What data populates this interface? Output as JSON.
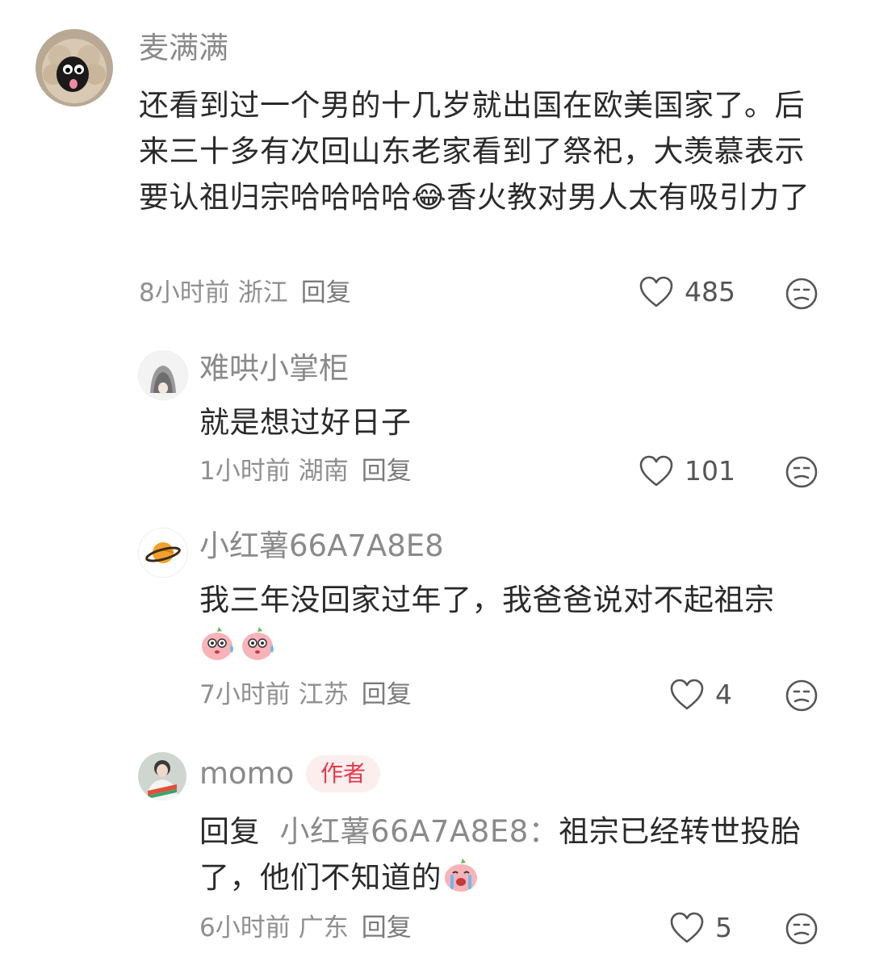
{
  "comments": [
    {
      "username": "麦满满",
      "text_before_emoji": "还看到过一个男的十几岁就出国在欧美国家了。后来三十多有次回山东老家看到了祭祀，大羡慕表示要认祖归宗哈哈哈哈",
      "emoji": "😂",
      "text_after_emoji": "香火教对男人太有吸引力了",
      "time": "8小时前",
      "location": "浙江",
      "reply_label": "回复",
      "likes": "485",
      "avatar_icon": "sheep-avatar"
    }
  ],
  "replies": [
    {
      "username": "难哄小掌柜",
      "text": "就是想过好日子",
      "time": "1小时前",
      "location": "湖南",
      "reply_label": "回复",
      "likes": "101",
      "avatar_icon": "grey-hair-avatar"
    },
    {
      "username": "小红薯66A7A8E8",
      "text": "我三年没回家过年了，我爸爸说对不起祖宗",
      "emoji_icon": "sweating-peach-emoji",
      "time": "7小时前",
      "location": "江苏",
      "reply_label": "回复",
      "likes": "4",
      "avatar_icon": "planet-avatar"
    },
    {
      "username": "momo",
      "badge": "作者",
      "reply_prefix": "回复",
      "mention": "小红薯66A7A8E8：",
      "text": "祖宗已经转世投胎了，他们不知道的",
      "emoji_icon": "crying-peach-emoji",
      "time": "6小时前",
      "location": "广东",
      "reply_label": "回复",
      "likes": "5",
      "avatar_icon": "photo-avatar"
    }
  ],
  "colors": {
    "name": "#8a8a8a",
    "text": "#2a2a2a",
    "meta": "#8f8f8f",
    "badge_bg": "#fdeeee",
    "badge_text": "#e8374b"
  }
}
